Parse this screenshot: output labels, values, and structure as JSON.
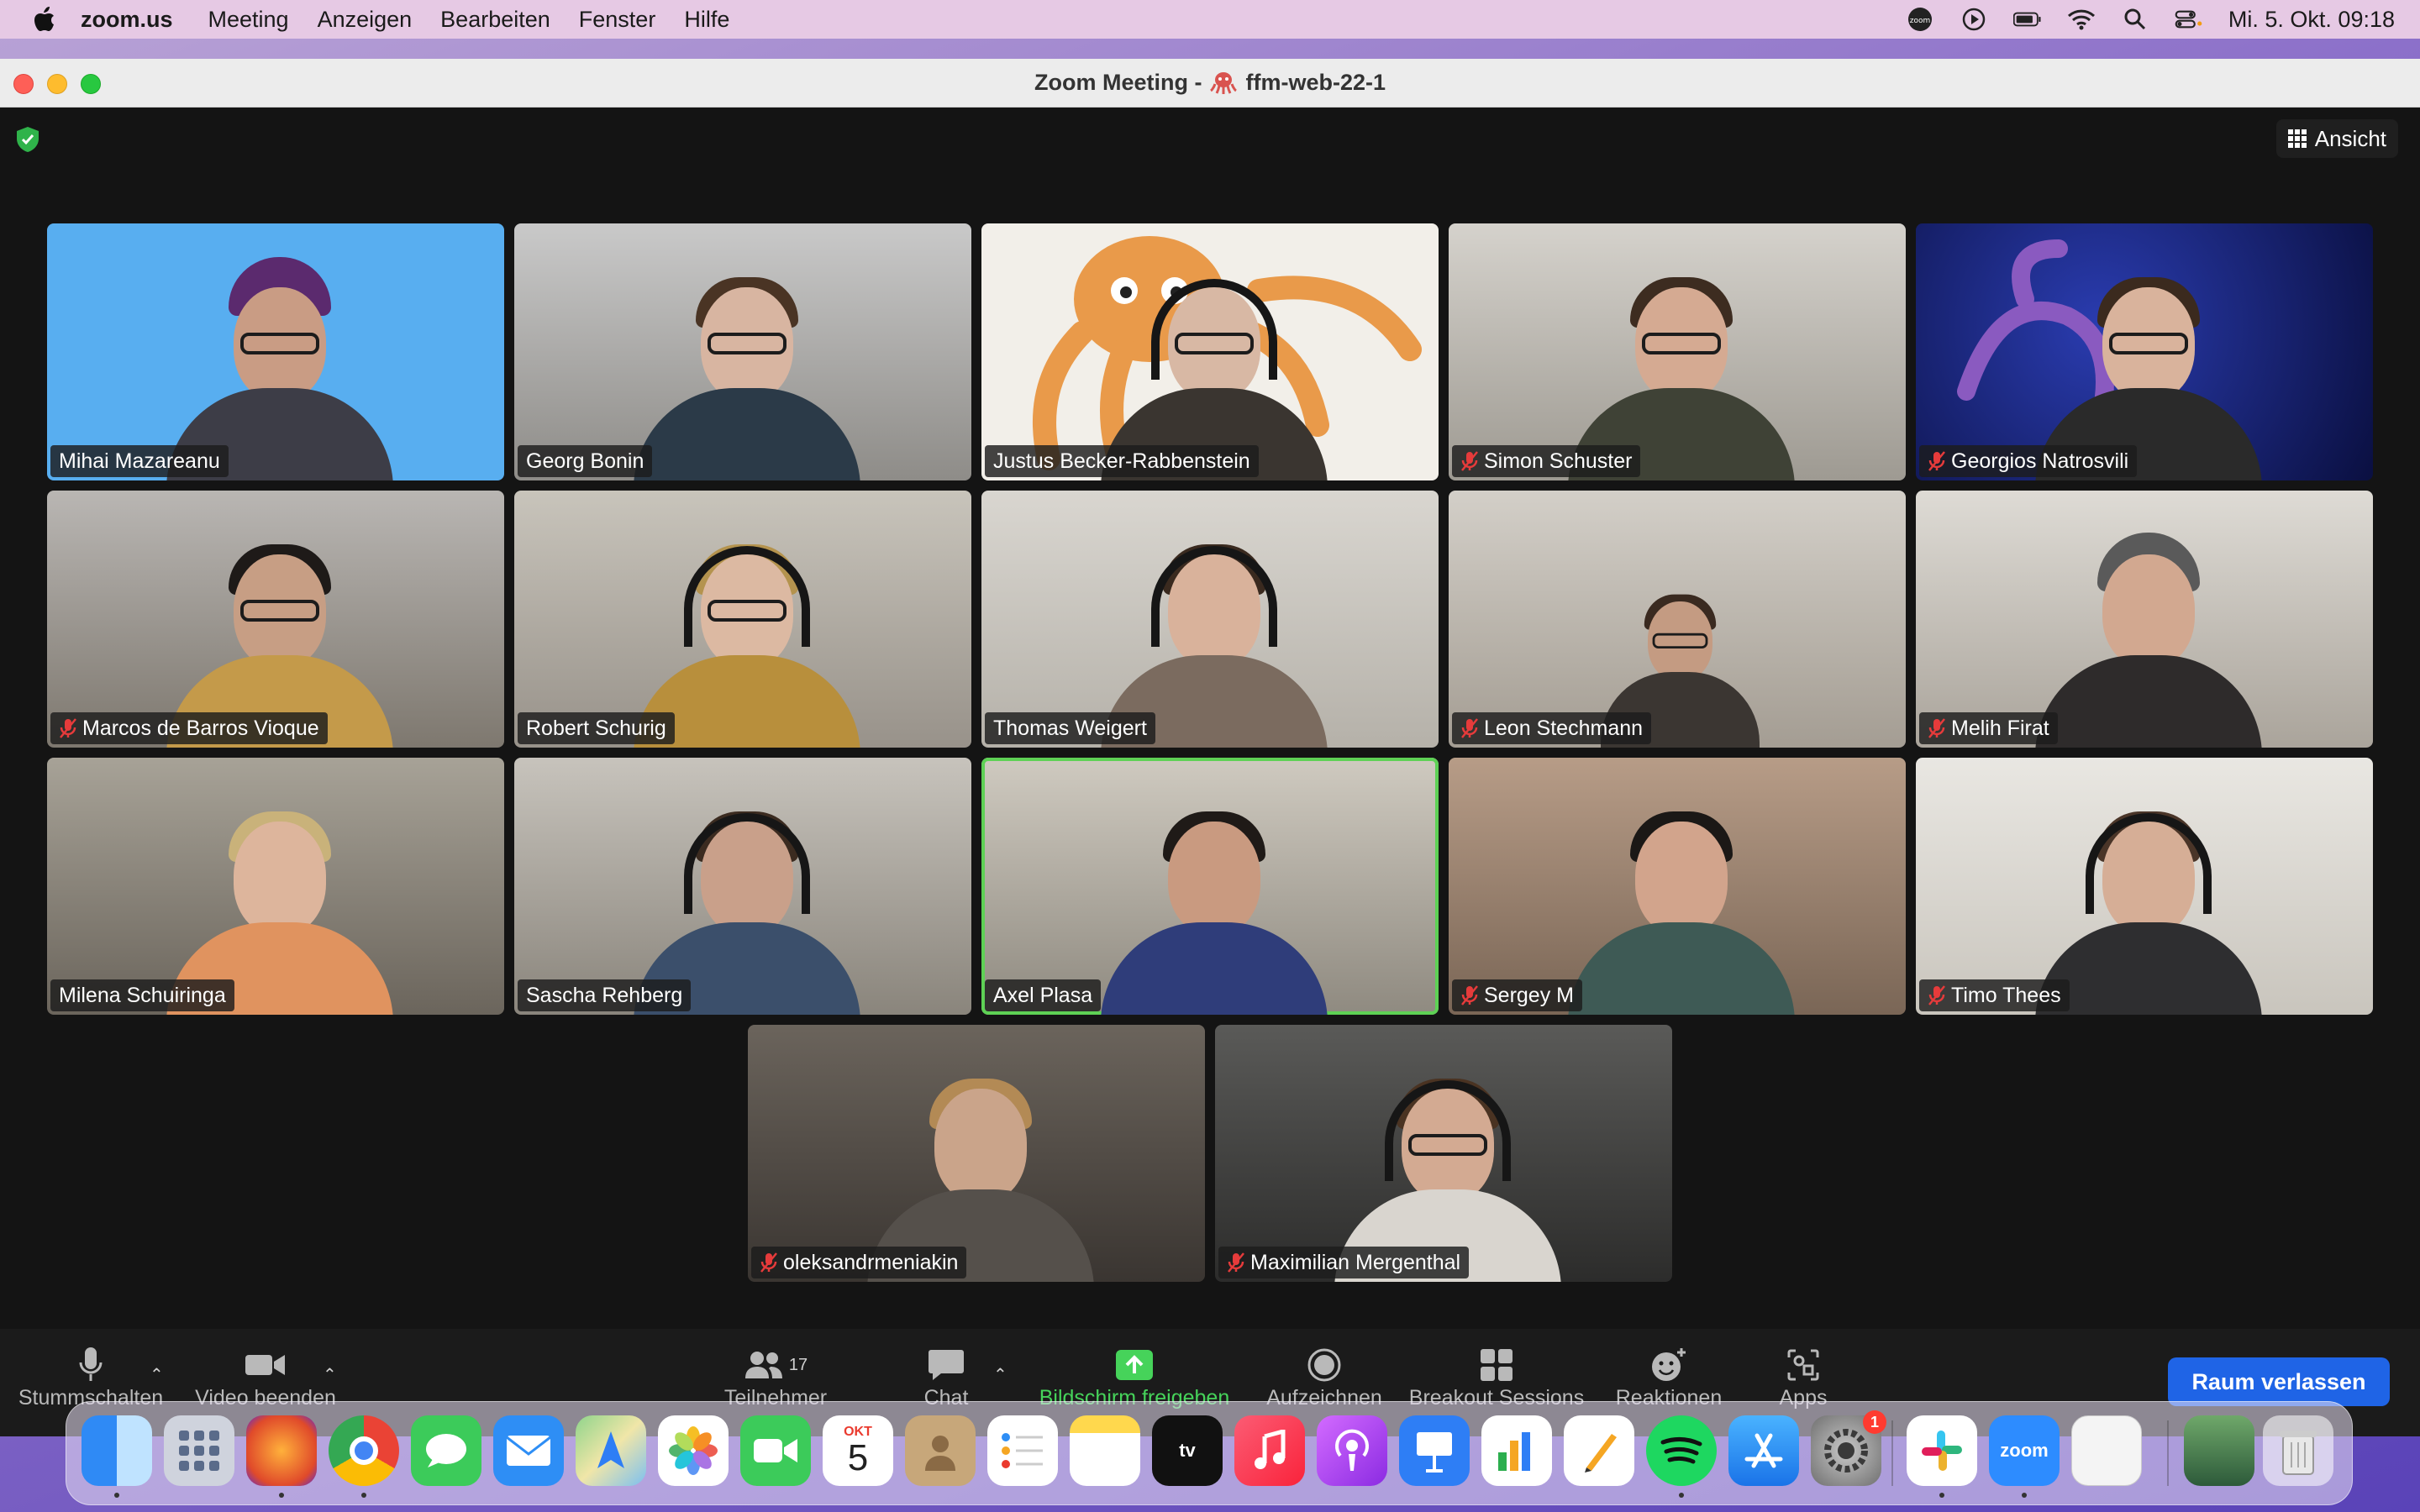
{
  "menubar": {
    "app_name": "zoom.us",
    "items": [
      "Meeting",
      "Anzeigen",
      "Bearbeiten",
      "Fenster",
      "Hilfe"
    ],
    "clock": "Mi. 5. Okt.  09:18"
  },
  "window": {
    "title_prefix": "Zoom Meeting -",
    "title_room": "ffm-web-22-1",
    "view_label": "Ansicht"
  },
  "participants": [
    {
      "name": "Mihai Mazareanu",
      "muted": false
    },
    {
      "name": "Georg Bonin",
      "muted": false
    },
    {
      "name": "Justus Becker-Rabbenstein",
      "muted": false
    },
    {
      "name": "Simon Schuster",
      "muted": true
    },
    {
      "name": "Georgios Natrosvili",
      "muted": true
    },
    {
      "name": "Marcos de Barros Vioque",
      "muted": true
    },
    {
      "name": "Robert Schurig",
      "muted": false
    },
    {
      "name": "Thomas Weigert",
      "muted": false
    },
    {
      "name": "Leon Stechmann",
      "muted": true
    },
    {
      "name": "Melih Firat",
      "muted": true
    },
    {
      "name": "Milena Schuiringa",
      "muted": false
    },
    {
      "name": "Sascha Rehberg",
      "muted": false
    },
    {
      "name": "Axel Plasa",
      "muted": false,
      "active_speaker": true
    },
    {
      "name": "Sergey M",
      "muted": true
    },
    {
      "name": "Timo Thees",
      "muted": true
    },
    {
      "name": "oleksandrmeniakin",
      "muted": true
    },
    {
      "name": "Maximilian Mergenthal",
      "muted": true
    }
  ],
  "toolbar": {
    "mute": "Stummschalten",
    "video": "Video beenden",
    "participants": "Teilnehmer",
    "participants_count": "17",
    "chat": "Chat",
    "share": "Bildschirm freigeben",
    "record": "Aufzeichnen",
    "breakout": "Breakout Sessions",
    "reactions": "Reaktionen",
    "apps": "Apps",
    "leave": "Raum verlassen"
  },
  "dock": {
    "calendar_month": "OKT",
    "calendar_day": "5",
    "tv_label": "tv",
    "zoom_label": "zoom",
    "settings_badge": "1"
  },
  "colors": {
    "active_speaker": "#5ed155",
    "share_green": "#46d35a",
    "leave_blue": "#1f64e6"
  }
}
